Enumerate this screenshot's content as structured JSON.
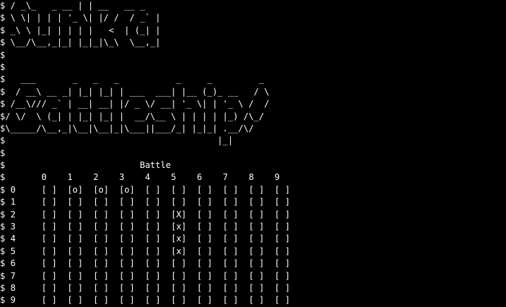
{
  "prompt": "$",
  "banner": {
    "sunk_lines": [
      " / _\\_   _ __ | | __   __ _ ",
      " \\ \\| | | | '_ \\| |/ /  / _` |",
      " _\\ \\ |_| | | | |   <  | (_| |",
      " \\__/\\__,_|_| |_|_|\\_\\  \\__,_|",
      ""
    ],
    "battleship_lines": [
      "",
      "   ___       _   _   _           _     _         _ ",
      "  / __\\ __ _| |_| |_| | ___  ___| |__ (_)_ __   / \\",
      " /__\\/// _` | __| __| |/ _ \\/ __| '_ \\| | '_ \\ /  /",
      "/ \\/  \\ (_| | |_| |_| |  __/\\__ \\ | | | | |_) /\\_/ ",
      "\\_____/\\__,_|\\__|\\__|_|\\___||___/_| |_|_| .__/\\/   ",
      "                                         |_|        ",
      ""
    ]
  },
  "board": {
    "title": "Battle",
    "columns": [
      "0",
      "1",
      "2",
      "3",
      "4",
      "5",
      "6",
      "7",
      "8",
      "9"
    ],
    "rows": [
      {
        "label": "0",
        "cells": [
          "[ ]",
          "[o]",
          "[o]",
          "[o]",
          "[ ]",
          "[ ]",
          "[ ]",
          "[ ]",
          "[ ]",
          "[ ]"
        ]
      },
      {
        "label": "1",
        "cells": [
          "[ ]",
          "[ ]",
          "[ ]",
          "[ ]",
          "[ ]",
          "[ ]",
          "[ ]",
          "[ ]",
          "[ ]",
          "[ ]"
        ]
      },
      {
        "label": "2",
        "cells": [
          "[ ]",
          "[ ]",
          "[ ]",
          "[ ]",
          "[ ]",
          "[X]",
          "[ ]",
          "[ ]",
          "[ ]",
          "[ ]"
        ]
      },
      {
        "label": "3",
        "cells": [
          "[ ]",
          "[ ]",
          "[ ]",
          "[ ]",
          "[ ]",
          "[x]",
          "[ ]",
          "[ ]",
          "[ ]",
          "[ ]"
        ]
      },
      {
        "label": "4",
        "cells": [
          "[ ]",
          "[ ]",
          "[ ]",
          "[ ]",
          "[ ]",
          "[x]",
          "[ ]",
          "[ ]",
          "[ ]",
          "[ ]"
        ]
      },
      {
        "label": "5",
        "cells": [
          "[ ]",
          "[ ]",
          "[ ]",
          "[ ]",
          "[ ]",
          "[x]",
          "[ ]",
          "[ ]",
          "[ ]",
          "[ ]"
        ]
      },
      {
        "label": "6",
        "cells": [
          "[ ]",
          "[ ]",
          "[ ]",
          "[ ]",
          "[ ]",
          "[ ]",
          "[ ]",
          "[ ]",
          "[ ]",
          "[ ]"
        ]
      },
      {
        "label": "7",
        "cells": [
          "[ ]",
          "[ ]",
          "[ ]",
          "[ ]",
          "[ ]",
          "[ ]",
          "[ ]",
          "[ ]",
          "[ ]",
          "[ ]"
        ]
      },
      {
        "label": "8",
        "cells": [
          "[ ]",
          "[ ]",
          "[ ]",
          "[ ]",
          "[ ]",
          "[ ]",
          "[ ]",
          "[ ]",
          "[ ]",
          "[ ]"
        ]
      },
      {
        "label": "9",
        "cells": [
          "[ ]",
          "[ ]",
          "[ ]",
          "[ ]",
          "[ ]",
          "[ ]",
          "[ ]",
          "[ ]",
          "[ ]",
          "[ ]"
        ]
      }
    ]
  },
  "colors": {
    "background": "#000000",
    "text": "#ffffff"
  }
}
